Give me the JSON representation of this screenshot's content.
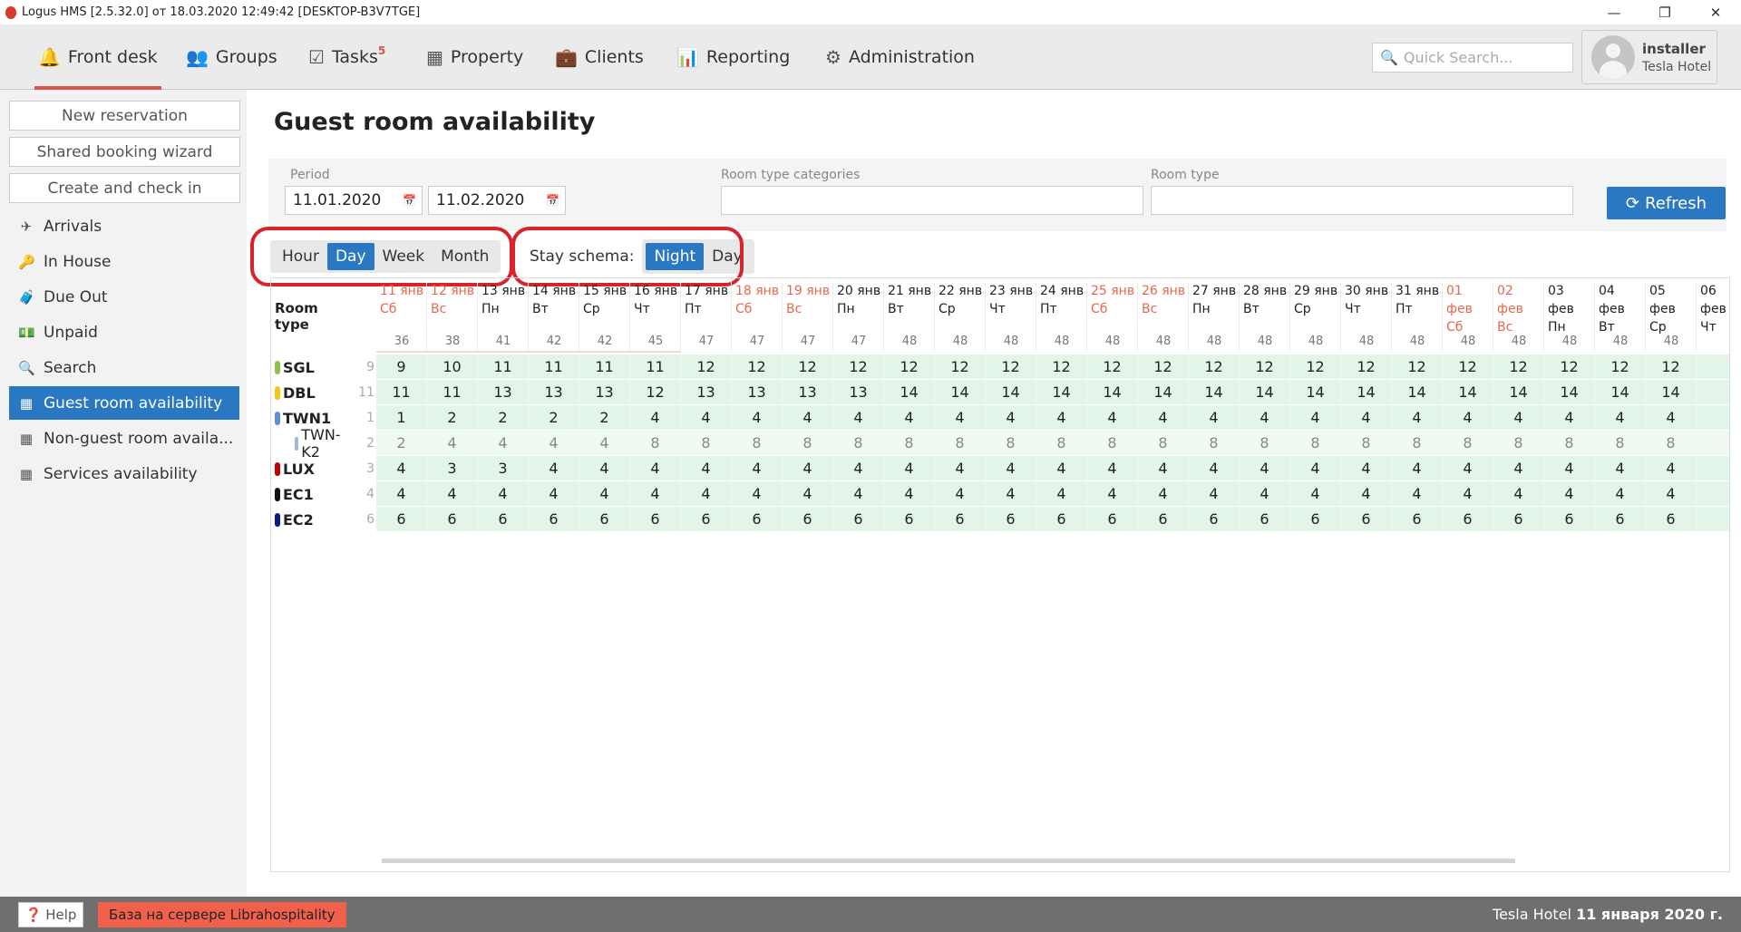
{
  "window": {
    "title": "Logus HMS [2.5.32.0] от 18.03.2020 12:49:42 [DESKTOP-B3V7TGE]",
    "minimize": "—",
    "maximize": "❐",
    "close": "✕"
  },
  "nav": {
    "items": [
      {
        "label": "Front desk",
        "icon": "🔔"
      },
      {
        "label": "Groups",
        "icon": "👥"
      },
      {
        "label": "Tasks",
        "icon": "☑",
        "badge": "5"
      },
      {
        "label": "Property",
        "icon": "▦"
      },
      {
        "label": "Clients",
        "icon": "💼"
      },
      {
        "label": "Reporting",
        "icon": "📊"
      },
      {
        "label": "Administration",
        "icon": "⚙"
      }
    ],
    "search_placeholder": "Quick Search...",
    "user_name": "installer",
    "user_hotel": "Tesla Hotel"
  },
  "sidebar": {
    "buttons": [
      "New reservation",
      "Shared booking wizard",
      "Create and check in"
    ],
    "items": [
      {
        "label": "Arrivals",
        "icon": "✈"
      },
      {
        "label": "In House",
        "icon": "🔑"
      },
      {
        "label": "Due Out",
        "icon": "🧳"
      },
      {
        "label": "Unpaid",
        "icon": "💵"
      },
      {
        "label": "Search",
        "icon": "🔍"
      },
      {
        "label": "Guest room availability",
        "icon": "▦"
      },
      {
        "label": "Non-guest room availa...",
        "icon": "▦"
      },
      {
        "label": "Services availability",
        "icon": "▦"
      }
    ]
  },
  "page": {
    "title": "Guest room availability"
  },
  "filters": {
    "period_label": "Period",
    "date_from": "11.01.2020",
    "date_to": "11.02.2020",
    "categories_label": "Room type categories",
    "categories_value": "",
    "room_type_label": "Room type",
    "room_type_value": "",
    "refresh": "Refresh"
  },
  "scale": {
    "options": [
      "Hour",
      "Day",
      "Week",
      "Month"
    ],
    "selected": "Day"
  },
  "stay": {
    "label": "Stay schema:",
    "options": [
      "Night",
      "Day"
    ],
    "selected": "Night"
  },
  "table": {
    "header_label": "Room type",
    "dates": [
      [
        "11 янв",
        "Сб",
        1
      ],
      [
        "12 янв",
        "Вс",
        1
      ],
      [
        "13 янв",
        "Пн",
        0
      ],
      [
        "14 янв",
        "Вт",
        0
      ],
      [
        "15 янв",
        "Ср",
        0
      ],
      [
        "16 янв",
        "Чт",
        0
      ],
      [
        "17 янв",
        "Пт",
        0
      ],
      [
        "18 янв",
        "Сб",
        1
      ],
      [
        "19 янв",
        "Вс",
        1
      ],
      [
        "20 янв",
        "Пн",
        0
      ],
      [
        "21 янв",
        "Вт",
        0
      ],
      [
        "22 янв",
        "Ср",
        0
      ],
      [
        "23 янв",
        "Чт",
        0
      ],
      [
        "24 янв",
        "Пт",
        0
      ],
      [
        "25 янв",
        "Сб",
        1
      ],
      [
        "26 янв",
        "Вс",
        1
      ],
      [
        "27 янв",
        "Пн",
        0
      ],
      [
        "28 янв",
        "Вт",
        0
      ],
      [
        "29 янв",
        "Ср",
        0
      ],
      [
        "30 янв",
        "Чт",
        0
      ],
      [
        "31 янв",
        "Пт",
        0
      ],
      [
        "01 фев",
        "Сб",
        1
      ],
      [
        "02 фев",
        "Вс",
        1
      ],
      [
        "03 фев",
        "Пн",
        0
      ],
      [
        "04 фев",
        "Вт",
        0
      ],
      [
        "05 фев",
        "Ср",
        0
      ],
      [
        "06 фев",
        "Чт",
        0
      ]
    ],
    "totals": [
      36,
      38,
      41,
      42,
      42,
      45,
      47,
      47,
      47,
      47,
      48,
      48,
      48,
      48,
      48,
      48,
      48,
      48,
      48,
      48,
      48,
      48,
      48,
      48,
      48,
      48
    ],
    "rows": [
      {
        "name": "SGL",
        "count": "9",
        "color": "#8bc34a",
        "sub": false,
        "values": [
          9,
          10,
          11,
          11,
          11,
          11,
          12,
          12,
          12,
          12,
          12,
          12,
          12,
          12,
          12,
          12,
          12,
          12,
          12,
          12,
          12,
          12,
          12,
          12,
          12,
          12
        ]
      },
      {
        "name": "DBL",
        "count": "11",
        "color": "#f5c518",
        "sub": false,
        "values": [
          11,
          11,
          13,
          13,
          13,
          12,
          13,
          13,
          13,
          13,
          14,
          14,
          14,
          14,
          14,
          14,
          14,
          14,
          14,
          14,
          14,
          14,
          14,
          14,
          14,
          14
        ]
      },
      {
        "name": "TWN1",
        "count": "1",
        "color": "#5b8fd6",
        "sub": false,
        "values": [
          1,
          2,
          2,
          2,
          2,
          4,
          4,
          4,
          4,
          4,
          4,
          4,
          4,
          4,
          4,
          4,
          4,
          4,
          4,
          4,
          4,
          4,
          4,
          4,
          4,
          4
        ]
      },
      {
        "name": "TWN-K2",
        "count": "2",
        "color": "#9ab8e0",
        "sub": true,
        "values": [
          2,
          4,
          4,
          4,
          4,
          8,
          8,
          8,
          8,
          8,
          8,
          8,
          8,
          8,
          8,
          8,
          8,
          8,
          8,
          8,
          8,
          8,
          8,
          8,
          8,
          8
        ]
      },
      {
        "name": "LUX",
        "count": "3",
        "color": "#c00000",
        "sub": false,
        "values": [
          4,
          3,
          3,
          4,
          4,
          4,
          4,
          4,
          4,
          4,
          4,
          4,
          4,
          4,
          4,
          4,
          4,
          4,
          4,
          4,
          4,
          4,
          4,
          4,
          4,
          4
        ]
      },
      {
        "name": "EC1",
        "count": "4",
        "color": "#111111",
        "sub": false,
        "values": [
          4,
          4,
          4,
          4,
          4,
          4,
          4,
          4,
          4,
          4,
          4,
          4,
          4,
          4,
          4,
          4,
          4,
          4,
          4,
          4,
          4,
          4,
          4,
          4,
          4,
          4
        ]
      },
      {
        "name": "EC2",
        "count": "6",
        "color": "#0a1a8a",
        "sub": false,
        "values": [
          6,
          6,
          6,
          6,
          6,
          6,
          6,
          6,
          6,
          6,
          6,
          6,
          6,
          6,
          6,
          6,
          6,
          6,
          6,
          6,
          6,
          6,
          6,
          6,
          6,
          6
        ]
      }
    ]
  },
  "footer": {
    "help": "Help",
    "db": "База на сервере Librahospitality",
    "hotel": "Tesla Hotel",
    "date": "11 января 2020 г."
  }
}
